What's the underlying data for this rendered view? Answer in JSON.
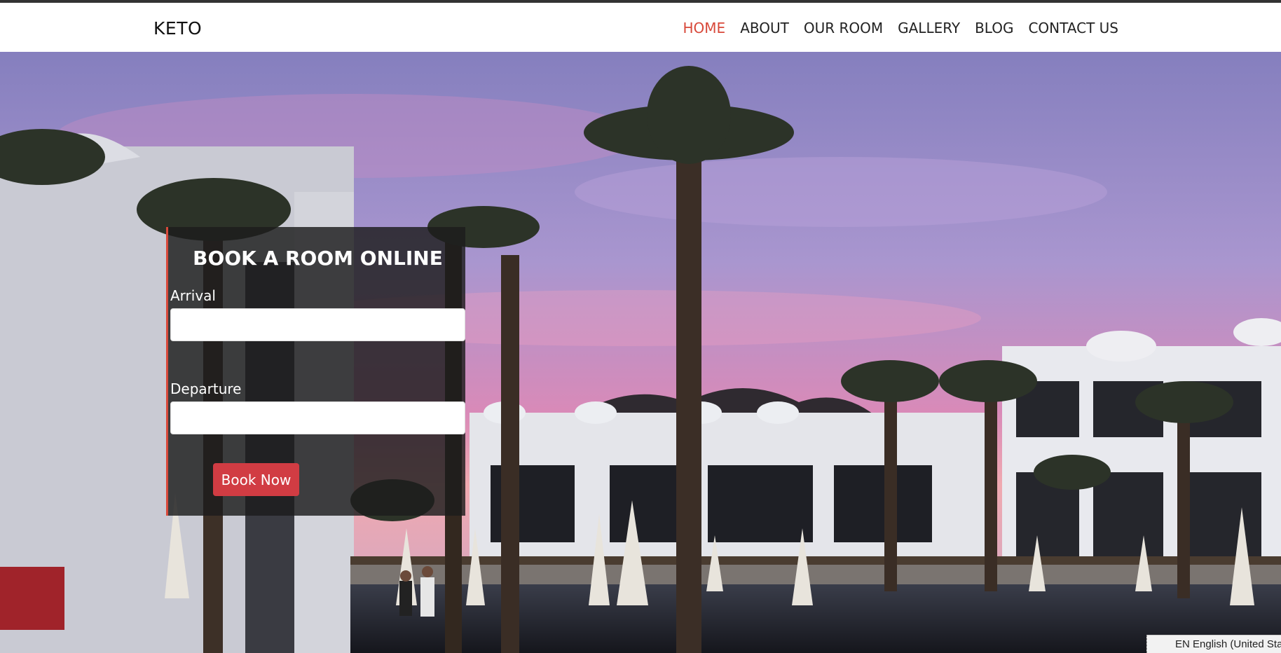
{
  "header": {
    "logo": "KETO",
    "nav": [
      {
        "label": "HOME",
        "active": true
      },
      {
        "label": "ABOUT",
        "active": false
      },
      {
        "label": "OUR ROOM",
        "active": false
      },
      {
        "label": "GALLERY",
        "active": false
      },
      {
        "label": "BLOG",
        "active": false
      },
      {
        "label": "CONTACT US",
        "active": false
      }
    ]
  },
  "booking": {
    "title": "BOOK A ROOM ONLINE",
    "arrival_label": "Arrival",
    "arrival_value": "",
    "departure_label": "Departure",
    "departure_value": "",
    "button_label": "Book Now"
  },
  "language_bar": {
    "text": "EN English (United States)"
  },
  "colors": {
    "accent": "#d8493a",
    "button": "#d13c43",
    "sky_top": "#8a86c4",
    "sky_pink": "#d98ab8"
  }
}
